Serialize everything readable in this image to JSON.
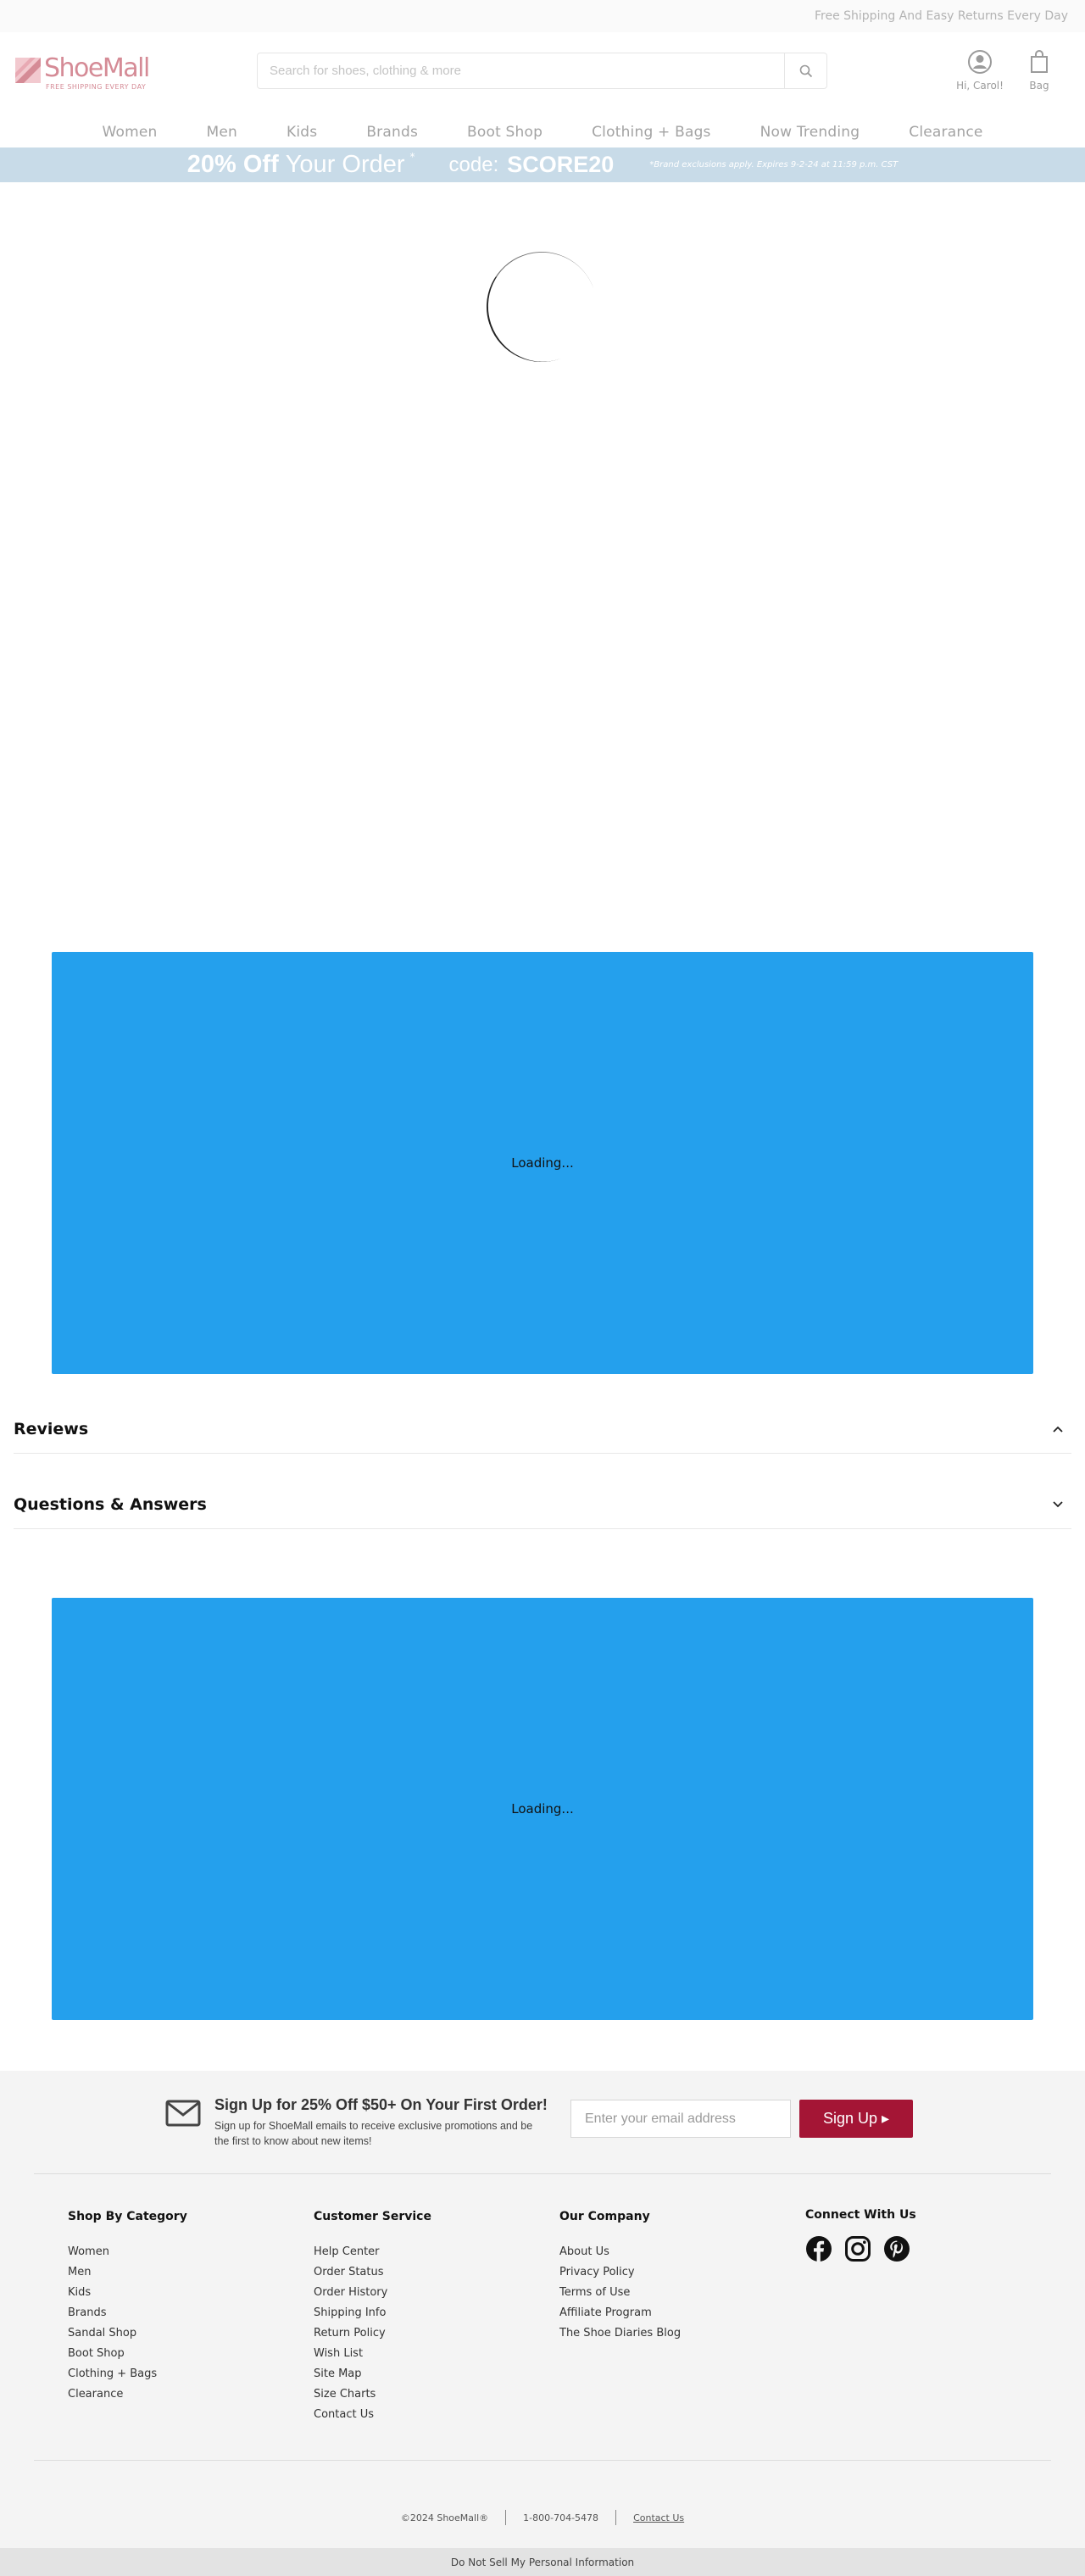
{
  "topbar": {
    "text": "Free Shipping And Easy Returns Every Day"
  },
  "header": {
    "logo_name": "ShoeMall",
    "logo_tagline": "FREE SHIPPING EVERY DAY",
    "search_placeholder": "Search for shoes, clothing & more",
    "account_label": "Hi, Carol!",
    "bag_label": "Bag"
  },
  "nav": {
    "items": [
      "Women",
      "Men",
      "Kids",
      "Brands",
      "Boot Shop",
      "Clothing + Bags",
      "Now Trending",
      "Clearance"
    ]
  },
  "promo": {
    "amount": "20% Off",
    "text": "Your Order",
    "asterisk": "*",
    "code_label": "code:",
    "code": "SCORE20",
    "fine_print": "*Brand exclusions apply. Expires 9-2-24 at 11:59 p.m. CST"
  },
  "main": {
    "loading_1": "Loading...",
    "reviews_title": "Reviews",
    "reviews_chevron": "⌃",
    "qa_title": "Questions & Answers",
    "qa_chevron": "⌄",
    "loading_2": "Loading..."
  },
  "footer": {
    "signup_title": "Sign Up for 25% Off $50+ On Your First Order!",
    "signup_sub": "Sign up for ShoeMall emails to receive exclusive promotions and be the first to know about new items!",
    "email_placeholder": "Enter your email address",
    "signup_button": "Sign Up ▸",
    "columns": [
      {
        "title": "Shop By Category",
        "items": [
          "Women",
          "Men",
          "Kids",
          "Brands",
          "Sandal Shop",
          "Boot Shop",
          "Clothing + Bags",
          "Clearance"
        ]
      },
      {
        "title": "Customer Service",
        "items": [
          "Help Center",
          "Order Status",
          "Order History",
          "Shipping Info",
          "Return Policy",
          "Wish List",
          "Site Map",
          "Size Charts",
          "Contact Us"
        ]
      },
      {
        "title": "Our Company",
        "items": [
          "About Us",
          "Privacy Policy",
          "Terms of Use",
          "Affiliate Program",
          "The Shoe Diaries Blog"
        ]
      }
    ],
    "connect_title": "Connect With Us",
    "social_icons": [
      "facebook-icon",
      "instagram-icon",
      "pinterest-icon"
    ],
    "copyright": "©2024 ShoeMall®",
    "phone": "1-800-704-5478",
    "contact_link": "Contact Us",
    "do_not_sell": "Do Not Sell My Personal Information"
  },
  "colors": {
    "promo_bg": "#c8dbe8",
    "loading_bg": "#24a0ed",
    "signup_button": "#a41535",
    "brand_pink": "#d58b96"
  }
}
